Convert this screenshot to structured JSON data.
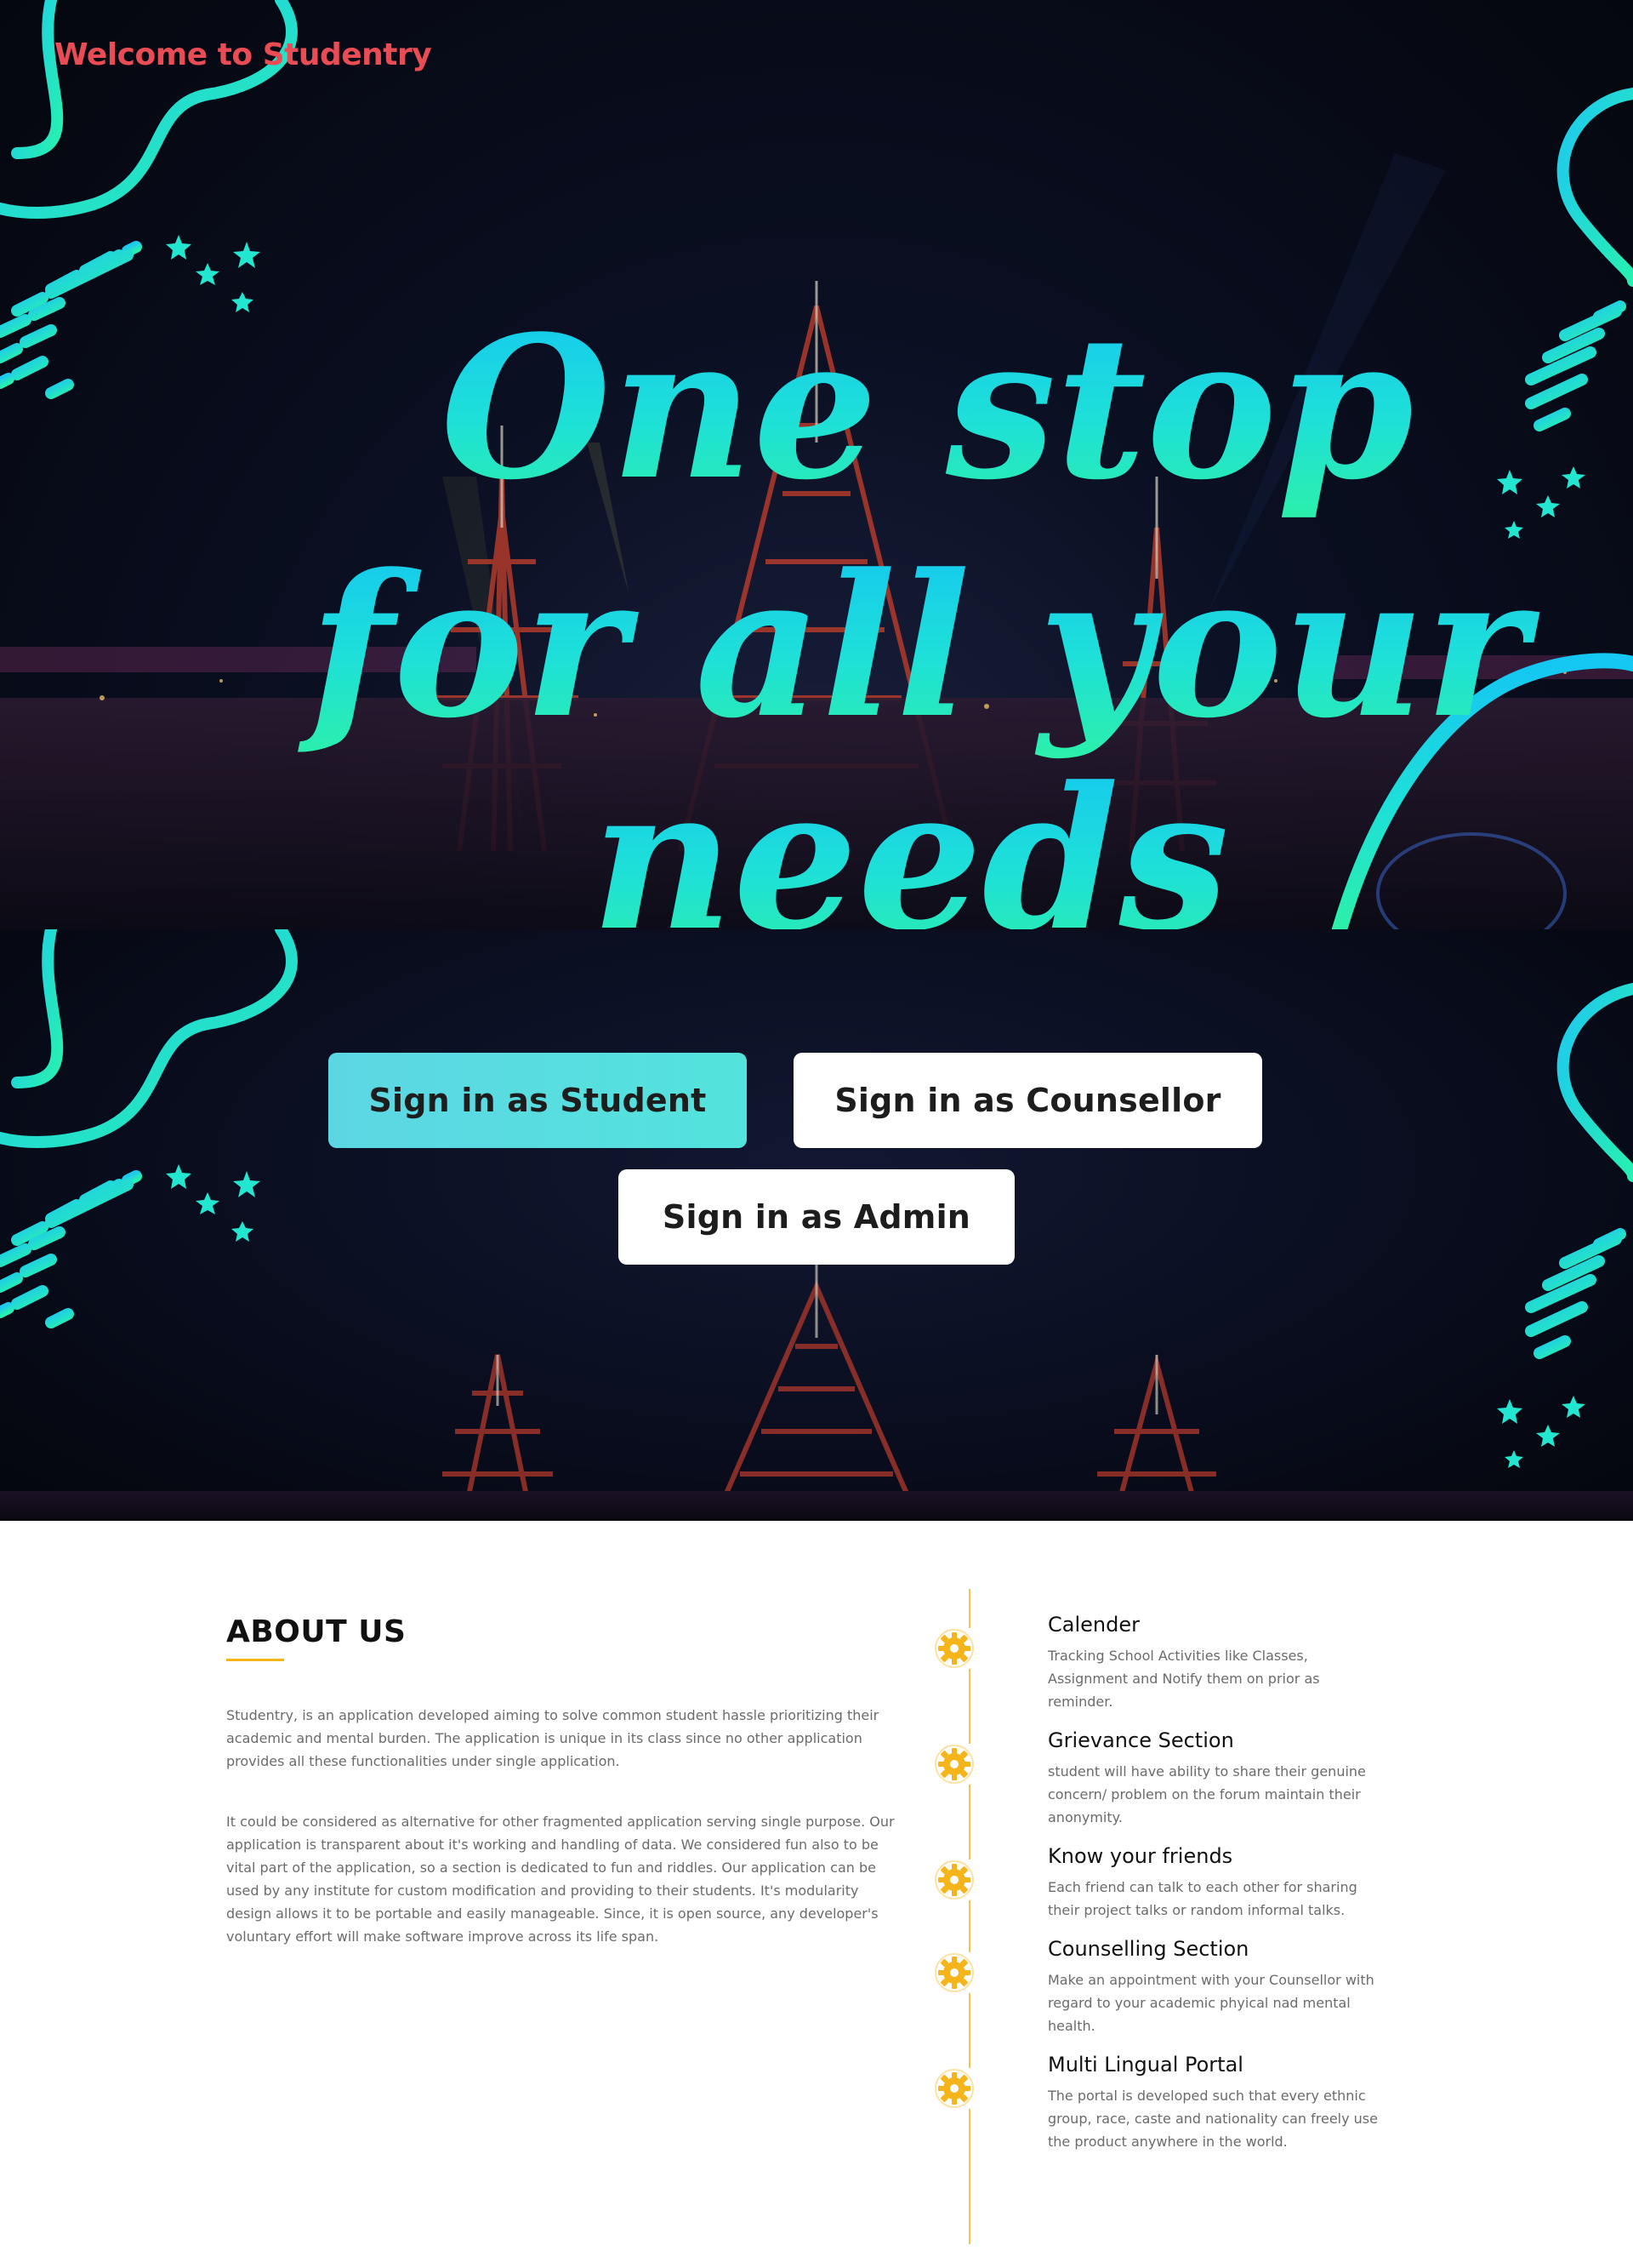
{
  "header": {
    "site_title": "Welcome to Studentry"
  },
  "hero": {
    "headline_line1": "One stop",
    "headline_line2": "for all your",
    "headline_line3": "needs"
  },
  "signin": {
    "student_label": "Sign in as Student",
    "counsellor_label": "Sign in as Counsellor",
    "admin_label": "Sign in as Admin"
  },
  "about": {
    "title": "ABOUT US",
    "paragraph1": "Studentry, is an application developed aiming to solve common student hassle prioritizing their academic and mental burden. The application is unique in its class since no other application provides all these functionalities under single application.",
    "paragraph2": "It could be considered as alternative for other fragmented application serving single purpose. Our application is transparent about it's working and handling of data. We considered fun also to be vital part of the application, so a section is dedicated to fun and riddles. Our application can be used by any institute for custom modification and providing to their students. It's modularity design allows it to be portable and easily manageable. Since, it is open source, any developer's voluntary effort will make software improve across its life span."
  },
  "features": [
    {
      "title": "Calender",
      "description": "Tracking School Activities like Classes, Assignment and Notify them on prior as reminder.",
      "icon": "gear-icon"
    },
    {
      "title": "Grievance Section",
      "description": "student will have ability to share their genuine concern/ problem on the forum maintain their anonymity.",
      "icon": "gear-icon"
    },
    {
      "title": "Know your friends",
      "description": "Each friend can talk to each other for sharing their project talks or random informal talks.",
      "icon": "gear-icon"
    },
    {
      "title": "Counselling Section",
      "description": "Make an appointment with your Counsellor with regard to your academic phyical nad mental health.",
      "icon": "gear-icon"
    },
    {
      "title": "Multi Lingual Portal",
      "description": "The portal is developed such that every ethnic group, race, caste and nationality can freely use the product anywhere in the world.",
      "icon": "gear-icon"
    }
  ],
  "colors": {
    "brand_red": "#e94c55",
    "accent_cyan": "#1ee0e8",
    "accent_teal": "#25e8b8",
    "accent_yellow": "#f4b41a"
  }
}
